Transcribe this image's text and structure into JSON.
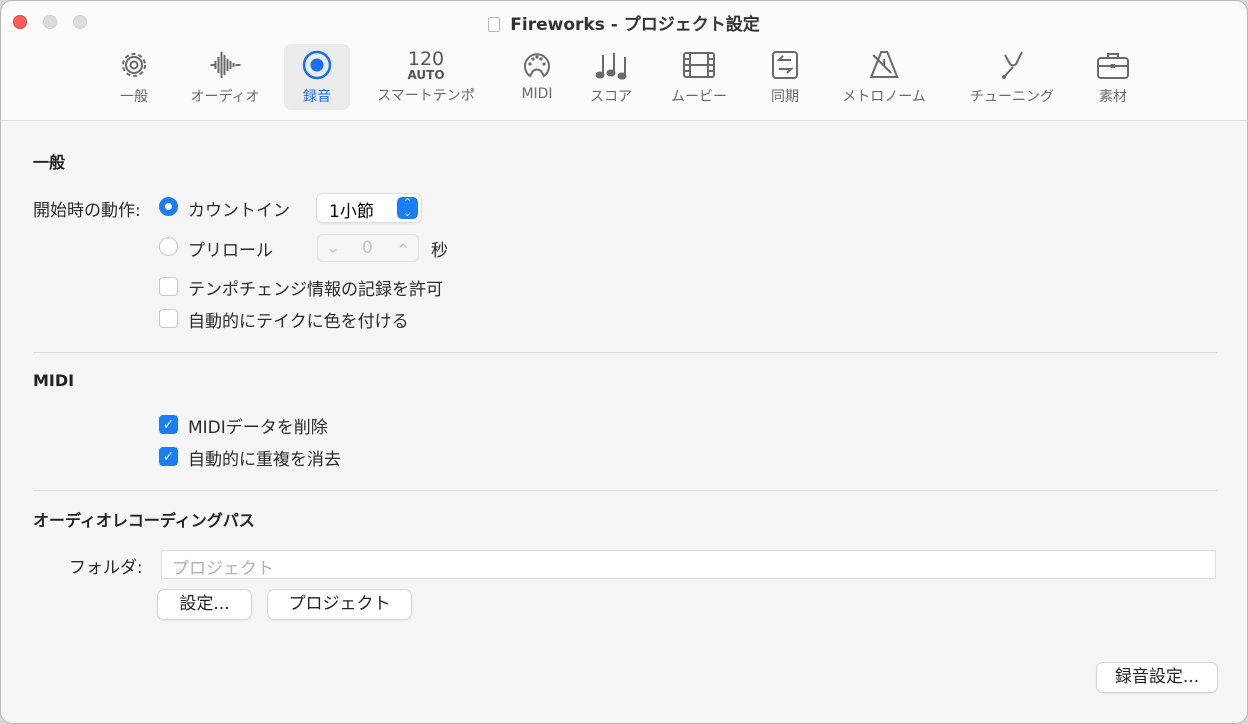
{
  "window": {
    "title": "Fireworks - プロジェクト設定"
  },
  "toolbar": {
    "items": [
      {
        "label": "一般",
        "icon": "gear-icon"
      },
      {
        "label": "オーディオ",
        "icon": "waveform-icon"
      },
      {
        "label": "録音",
        "icon": "record-icon",
        "selected": true
      },
      {
        "label": "スマートテンポ",
        "icon": "tempo-icon",
        "tempo": "120",
        "auto": "AUTO"
      },
      {
        "label": "MIDI",
        "icon": "midi-icon"
      },
      {
        "label": "スコア",
        "icon": "notes-icon"
      },
      {
        "label": "ムービー",
        "icon": "film-icon"
      },
      {
        "label": "同期",
        "icon": "sync-icon"
      },
      {
        "label": "メトロノーム",
        "icon": "metronome-icon"
      },
      {
        "label": "チューニング",
        "icon": "tuning-fork-icon"
      },
      {
        "label": "素材",
        "icon": "briefcase-icon"
      }
    ]
  },
  "general": {
    "heading": "一般",
    "start_label": "開始時の動作:",
    "count_in": "カウントイン",
    "count_in_value": "1小節",
    "preroll": "プリロール",
    "preroll_value": "0",
    "preroll_unit": "秒",
    "allow_tempo": "テンポチェンジ情報の記録を許可",
    "auto_color": "自動的にテイクに色を付ける"
  },
  "midi": {
    "heading": "MIDI",
    "delete_midi": "MIDIデータを削除",
    "auto_merge": "自動的に重複を消去"
  },
  "path": {
    "heading": "オーディオレコーディングパス",
    "folder_label": "フォルダ:",
    "folder_placeholder": "プロジェクト",
    "set_button": "設定...",
    "project_button": "プロジェクト"
  },
  "footer": {
    "record_settings_button": "録音設定..."
  },
  "colors": {
    "accent": "#1a7ff7",
    "close": "#ff5f57"
  }
}
